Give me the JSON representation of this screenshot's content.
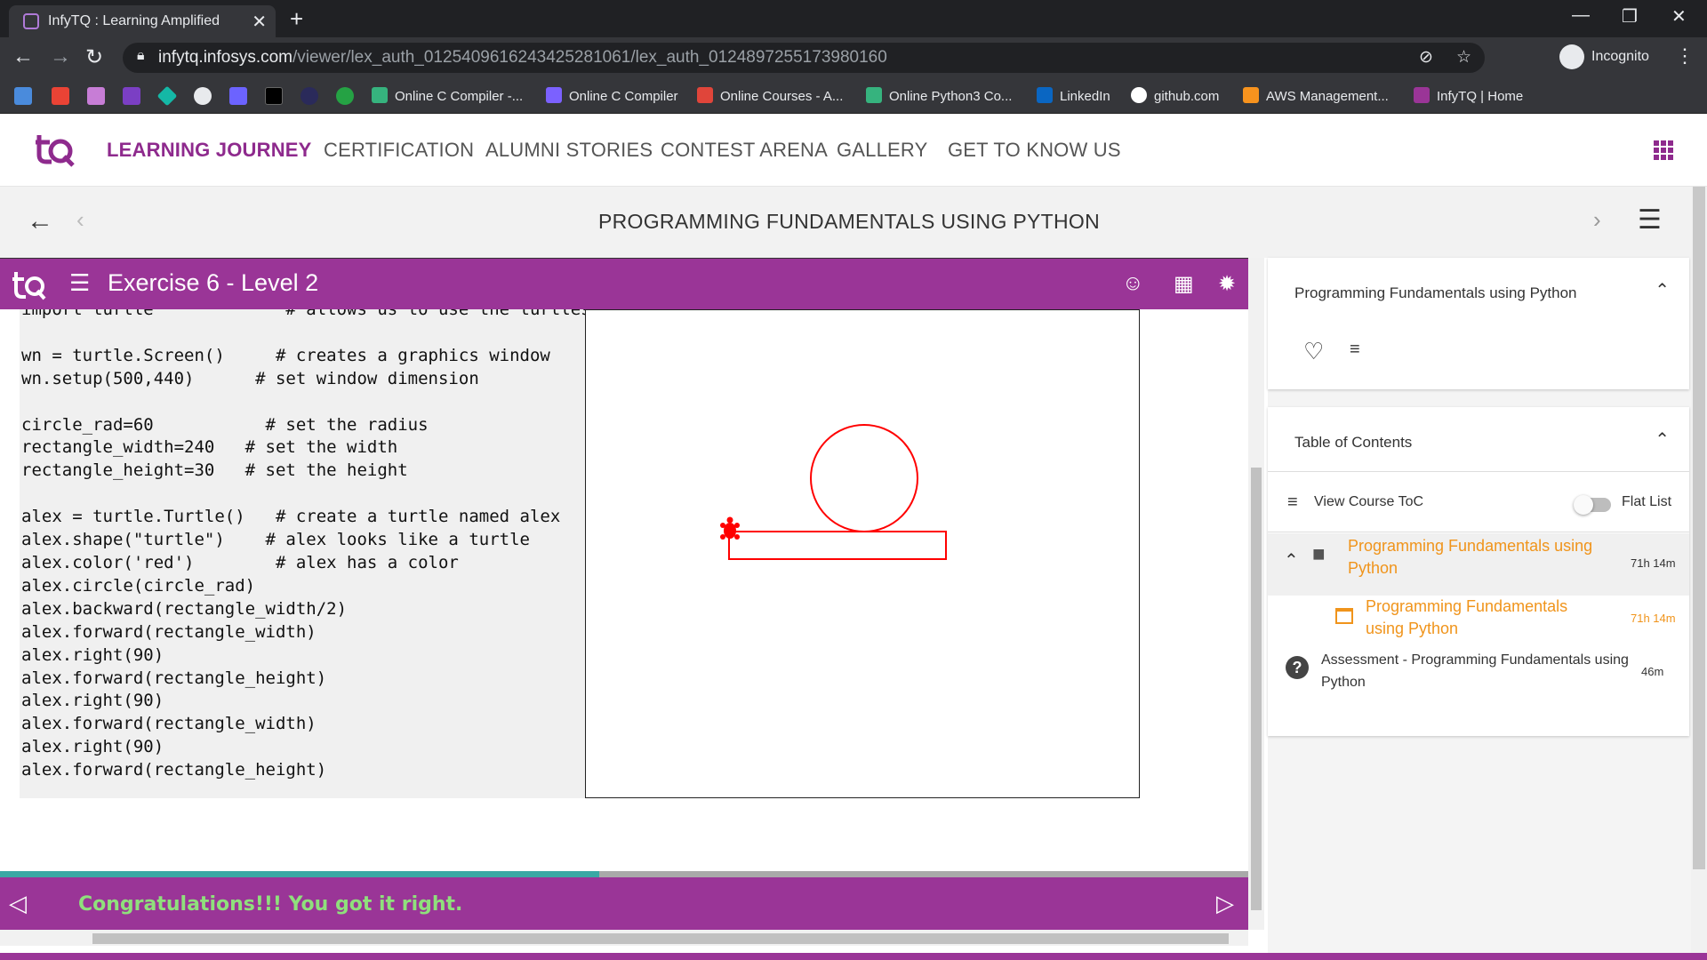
{
  "browser": {
    "tab_title": "InfyTQ : Learning Amplified",
    "url_host": "infytq.infosys.com",
    "url_path": "/viewer/lex_auth_0125409616243425281061/lex_auth_0124897255173980160",
    "incognito_label": "Incognito",
    "bookmarks": [
      {
        "label": "Online C Compiler -...",
        "color": "#36b37e"
      },
      {
        "label": "Online C Compiler",
        "color": "#7b61ff"
      },
      {
        "label": "Online Courses - A...",
        "color": "#e0453a"
      },
      {
        "label": "Online Python3 Co...",
        "color": "#36b37e"
      },
      {
        "label": "LinkedIn",
        "color": "#0a66c2"
      },
      {
        "label": "github.com",
        "color": "#ffffff"
      },
      {
        "label": "AWS Management...",
        "color": "#f7931e"
      },
      {
        "label": "InfyTQ | Home",
        "color": "#9a3597"
      }
    ]
  },
  "site": {
    "nav": [
      {
        "label": "LEARNING JOURNEY",
        "active": true
      },
      {
        "label": "CERTIFICATION"
      },
      {
        "label": "ALUMNI STORIES"
      },
      {
        "label": "CONTEST ARENA"
      },
      {
        "label": "GALLERY"
      },
      {
        "label": "GET TO KNOW US"
      }
    ],
    "brand_color": "#9a3597",
    "course_title": "PROGRAMMING FUNDAMENTALS USING PYTHON"
  },
  "exercise": {
    "title": "Exercise 6 - Level 2",
    "code": "import turtle             # allows us to use the turtles library\n\nwn = turtle.Screen()     # creates a graphics window\nwn.setup(500,440)      # set window dimension\n\ncircle_rad=60           # set the radius\nrectangle_width=240   # set the width\nrectangle_height=30   # set the height\n\nalex = turtle.Turtle()   # create a turtle named alex\nalex.shape(\"turtle\")    # alex looks like a turtle\nalex.color('red')        # alex has a color\nalex.circle(circle_rad)\nalex.backward(rectangle_width/2)\nalex.forward(rectangle_width)\nalex.right(90)\nalex.forward(rectangle_height)\nalex.right(90)\nalex.forward(rectangle_width)\nalex.right(90)\nalex.forward(rectangle_height)",
    "drawing_color": "#ff0000",
    "feedback": "Congratulations!!! You got it right.",
    "feedback_color": "#8fe07c",
    "progress_fraction": 0.48
  },
  "sidebar": {
    "course_card_title": "Programming Fundamentals using Python",
    "toc_title": "Table of Contents",
    "view_toc_label": "View Course ToC",
    "flat_list_label": "Flat List",
    "toc": [
      {
        "label": "Programming Fundamentals using Python",
        "duration": "71h 14m"
      },
      {
        "label": "Programming Fundamentals using Python",
        "duration": "71h 14m"
      },
      {
        "label": "Assessment - Programming Fundamentals using Python",
        "duration": "46m"
      }
    ]
  }
}
